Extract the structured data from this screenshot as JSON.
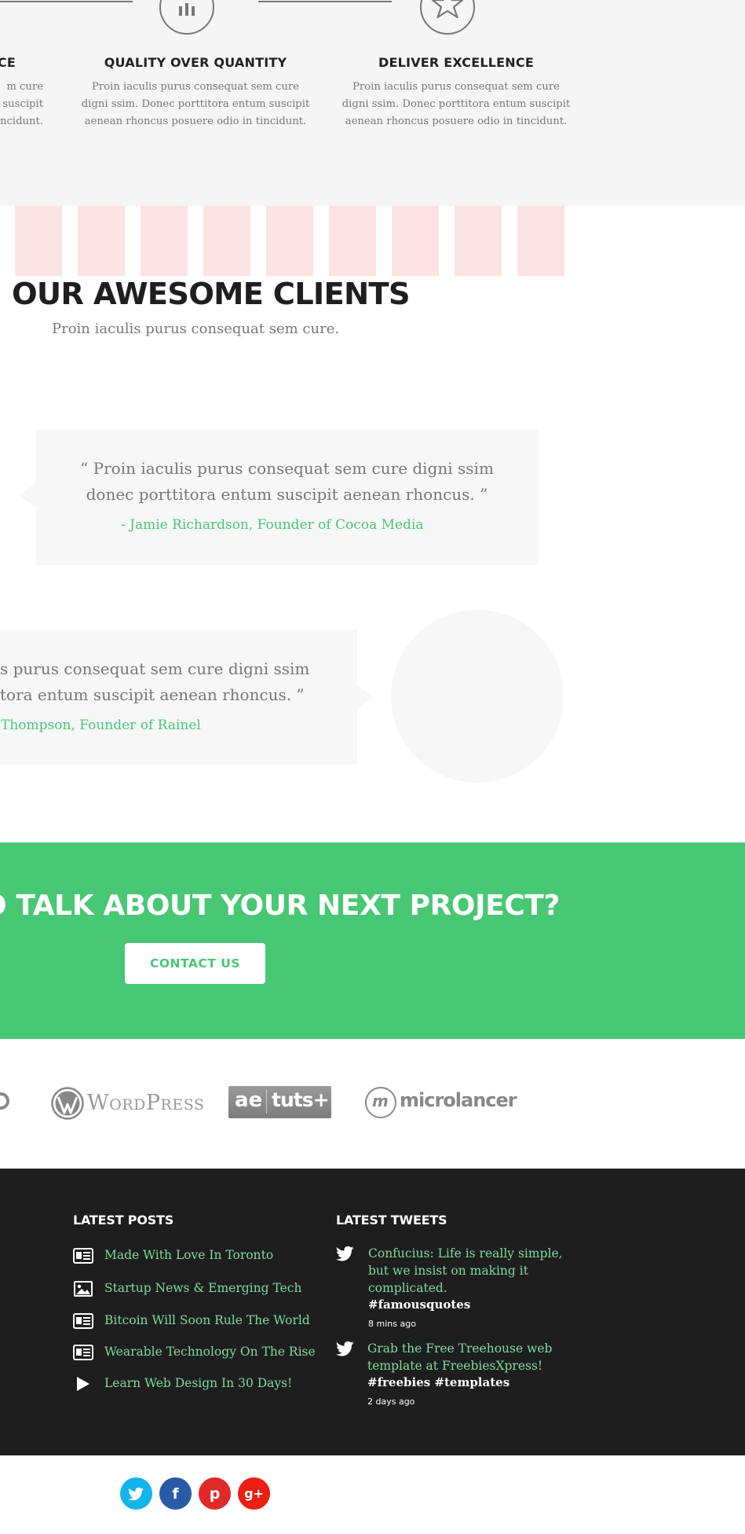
{
  "features": [
    {
      "title": "QUALITY OVER QUANTITY",
      "text_lines": [
        "Proin iaculis purus consequat sem cure",
        "digni ssim. Donec porttitora entum suscipit",
        "aenean rhoncus posuere odio in tincidunt."
      ],
      "icon": "bar-chart-icon"
    },
    {
      "title": "DELIVER EXCELLENCE",
      "text_lines": [
        "Proin iaculis purus consequat sem cure",
        "digni ssim. Donec porttitora entum suscipit",
        "aenean rhoncus posuere odio in tincidunt."
      ],
      "icon": "star-icon"
    }
  ],
  "feature_partial": {
    "title": "CE",
    "text_lines": [
      "m cure",
      "n suscipit",
      "incidunt."
    ]
  },
  "clients": {
    "title": "OUR AWESOME CLIENTS",
    "subtitle": "Proin iaculis purus consequat sem cure."
  },
  "testimonials": [
    {
      "quote_lines": [
        "“ Proin iaculis purus consequat sem cure  digni ssim",
        "donec porttitora entum suscipit aenean rhoncus. ”"
      ],
      "author": "- Jamie Richardson, Founder of Cocoa Media"
    },
    {
      "quote_lines": [
        "s purus consequat sem cure  digni ssim",
        "tora entum suscipit aenean rhoncus. ”"
      ],
      "author": "Thompson, Founder of Rainel"
    }
  ],
  "cta": {
    "title": "O TALK ABOUT YOUR NEXT PROJECT?",
    "button": "CONTACT US"
  },
  "partners": {
    "wordpress": "WordPress",
    "tuts_left": "ae",
    "tuts_right": "tuts+",
    "microlancer": "microlancer",
    "microlancer_mark": "m"
  },
  "footer": {
    "posts_heading": "LATEST POSTS",
    "posts": [
      {
        "label": "Made With Love In Toronto",
        "icon": "article-icon"
      },
      {
        "label": "Startup News & Emerging Tech",
        "icon": "image-icon"
      },
      {
        "label": "Bitcoin Will Soon Rule The World",
        "icon": "article-icon"
      },
      {
        "label": "Wearable Technology On The Rise",
        "icon": "article-icon"
      },
      {
        "label": "Learn Web Design In 30 Days!",
        "icon": "play-icon"
      }
    ],
    "tweets_heading": "LATEST TWEETS",
    "tweets": [
      {
        "text": "Confucius: Life is really simple, but we insist on making it complicated.",
        "tags": "#famousquotes",
        "time": "8 mins ago",
        "icon": "twitter-bird-icon"
      },
      {
        "text": "Grab the Free Treehouse web template at FreebiesXpress!",
        "tags": "#freebies #templates",
        "time": "2 days ago",
        "icon": "twitter-bird-icon"
      }
    ]
  },
  "social": {
    "twitter": "t",
    "facebook": "f",
    "pinterest": "p",
    "googleplus": "g+",
    "colors": {
      "twitter": "#13b4ea",
      "facebook": "#2a5ba5",
      "pinterest": "#e02a2a",
      "googleplus": "#eb1f12"
    }
  },
  "colors": {
    "accent": "#48c774",
    "footer_bg": "#1e1e1e",
    "link": "#7fd9a1",
    "logo_placeholder": "#fde3e3"
  }
}
